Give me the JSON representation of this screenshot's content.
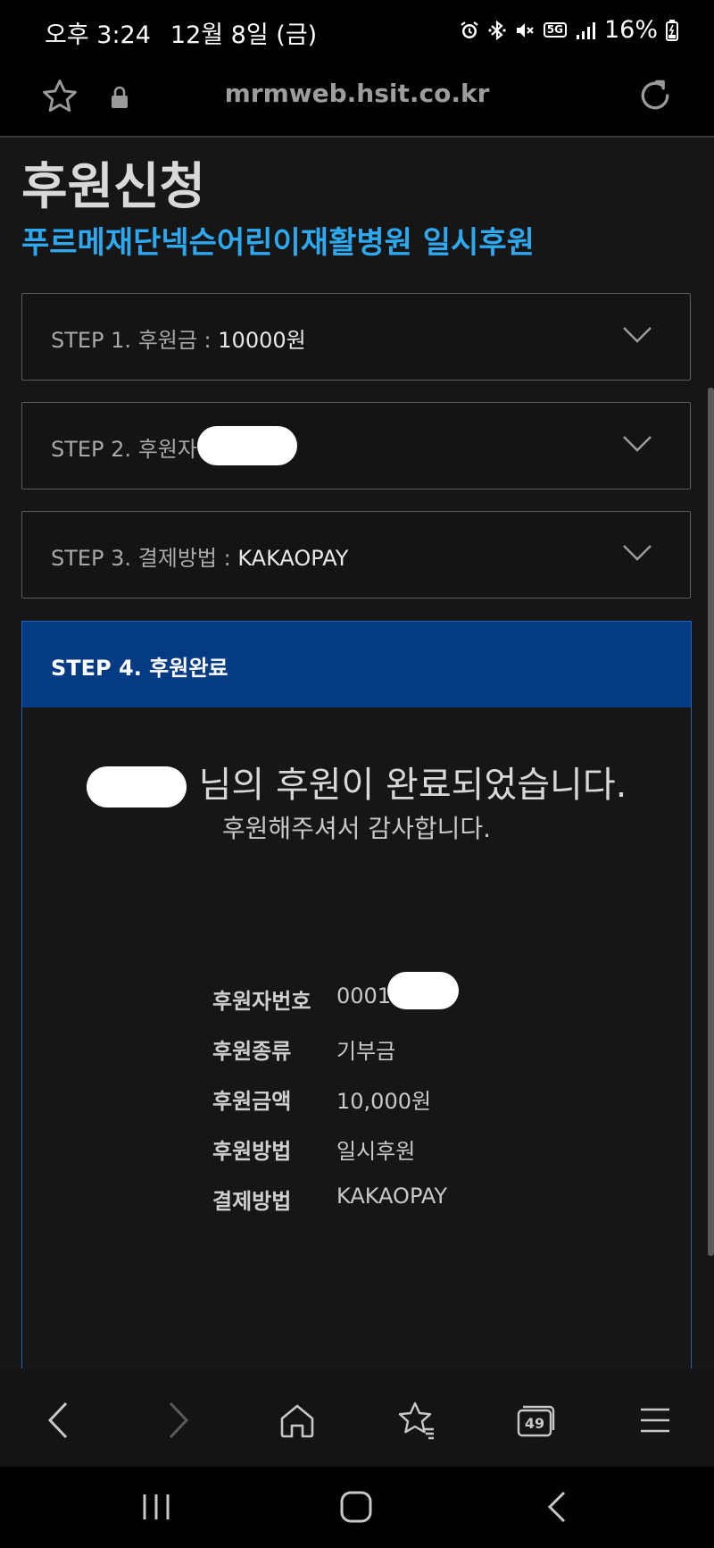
{
  "status_bar": {
    "time": "오후 3:24",
    "date": "12월 8일 (금)",
    "network": "5G",
    "battery": "16%"
  },
  "browser": {
    "url": "mrmweb.hsit.co.kr"
  },
  "page": {
    "title": "후원신청",
    "subtitle": "푸르메재단넥슨어린이재활병원 일시후원"
  },
  "steps": [
    {
      "label": "STEP 1. 후원금 : ",
      "value": "10000원"
    },
    {
      "label": "STEP 2. 후원자",
      "value": ""
    },
    {
      "label": "STEP 3. 결제방법 : ",
      "value": "KAKAOPAY"
    }
  ],
  "step4": {
    "title": "STEP 4. 후원완료",
    "message": "님의 후원이 완료되었습니다.",
    "thanks": "후원해주셔서 감사합니다.",
    "details": [
      {
        "key": "후원자번호",
        "value": "0001"
      },
      {
        "key": "후원종류",
        "value": "기부금"
      },
      {
        "key": "후원금액",
        "value": "10,000원"
      },
      {
        "key": "후원방법",
        "value": "일시후원"
      },
      {
        "key": "결제방법",
        "value": "KAKAOPAY"
      }
    ]
  },
  "toolbar": {
    "tab_count": "49"
  },
  "colors": {
    "accent": "#2ea8ef",
    "step4_header": "#053b82",
    "background": "#161617"
  }
}
